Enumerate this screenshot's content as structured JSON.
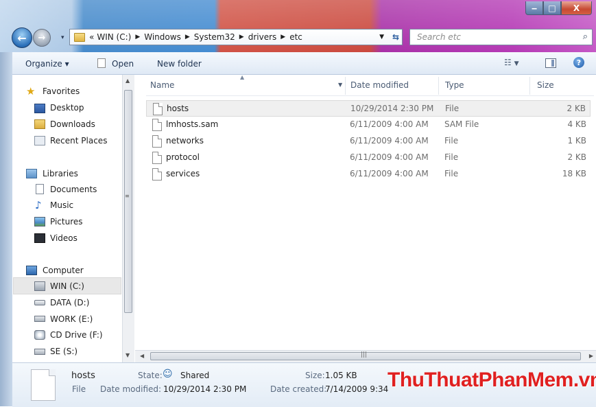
{
  "window": {
    "min_glyph": "‒",
    "max_glyph": "□",
    "close_glyph": "X"
  },
  "address": {
    "overflow": "«",
    "crumbs": [
      "WIN (C:)",
      "Windows",
      "System32",
      "drivers",
      "etc"
    ]
  },
  "search": {
    "placeholder": "Search etc"
  },
  "toolbar": {
    "organize": "Organize ▾",
    "open": "Open",
    "new_folder": "New folder"
  },
  "nav": {
    "favorites": "Favorites",
    "desktop": "Desktop",
    "downloads": "Downloads",
    "recent": "Recent Places",
    "libraries": "Libraries",
    "documents": "Documents",
    "music": "Music",
    "pictures": "Pictures",
    "videos": "Videos",
    "computer": "Computer",
    "win": "WIN (C:)",
    "data": "DATA (D:)",
    "work": "WORK (E:)",
    "cd": "CD Drive (F:)",
    "se": "SE (S:)"
  },
  "columns": {
    "name": "Name",
    "date": "Date modified",
    "type": "Type",
    "size": "Size"
  },
  "files": [
    {
      "name": "hosts",
      "date": "10/29/2014 2:30 PM",
      "type": "File",
      "size": "2 KB"
    },
    {
      "name": "lmhosts.sam",
      "date": "6/11/2009 4:00 AM",
      "type": "SAM File",
      "size": "4 KB"
    },
    {
      "name": "networks",
      "date": "6/11/2009 4:00 AM",
      "type": "File",
      "size": "1 KB"
    },
    {
      "name": "protocol",
      "date": "6/11/2009 4:00 AM",
      "type": "File",
      "size": "2 KB"
    },
    {
      "name": "services",
      "date": "6/11/2009 4:00 AM",
      "type": "File",
      "size": "18 KB"
    }
  ],
  "details": {
    "name": "hosts",
    "kind": "File",
    "state_label": "State:",
    "state_value": "Shared",
    "modified_label": "Date modified:",
    "modified_value": "10/29/2014 2:30 PM",
    "size_label": "Size:",
    "size_value": "1.05 KB",
    "created_label": "Date created:",
    "created_value": "7/14/2009 9:34"
  },
  "watermark": "ThuThuatPhanMem.vn",
  "colors": {
    "selected_row": "#f0f0f0",
    "selected_nav": "#e8e8e8",
    "watermark": "#e02020"
  }
}
